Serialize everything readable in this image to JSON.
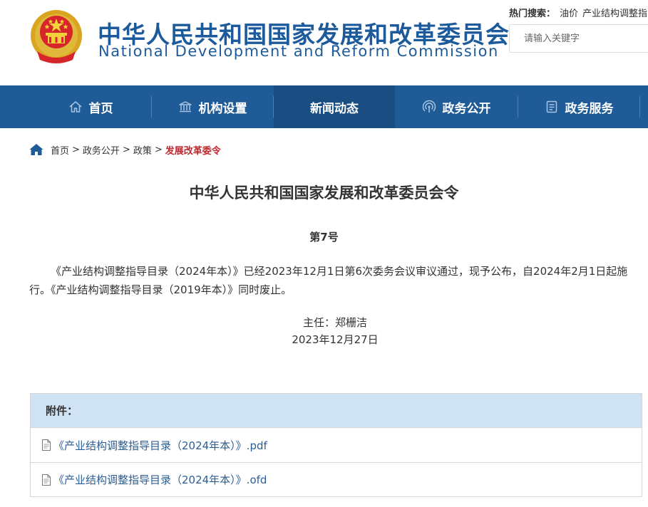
{
  "header": {
    "title_cn": "中华人民共和国国家发展和改革委员会",
    "title_en": "National Development and Reform Commission",
    "hot_search_label": "热门搜索：",
    "hot_search_links": [
      "油价",
      "产业结构调整指"
    ],
    "search_placeholder": "请输入关键字"
  },
  "nav": {
    "items": [
      {
        "label": "首页",
        "icon": "home-outline-icon"
      },
      {
        "label": "机构设置",
        "icon": "institution-building-icon"
      },
      {
        "label": "新闻动态",
        "icon": ""
      },
      {
        "label": "政务公开",
        "icon": "broadcast-icon"
      },
      {
        "label": "政务服务",
        "icon": "document-service-icon"
      }
    ],
    "active_index": 2
  },
  "breadcrumb": {
    "items": [
      "首页",
      "政务公开",
      "政策"
    ],
    "separator": ">",
    "current": "发展改革委令"
  },
  "article": {
    "title": "中华人民共和国国家发展和改革委员会令",
    "number": "第7号",
    "body": "《产业结构调整指导目录（2024年本）》已经2023年12月1日第6次委务会议审议通过，现予公布，自2024年2月1日起施行。《产业结构调整指导目录（2019年本）》同时废止。",
    "signer": "主任：郑栅洁",
    "date": "2023年12月27日"
  },
  "attachments": {
    "heading": "附件：",
    "files": [
      {
        "name": "《产业结构调整指导目录（2024年本）》.pdf"
      },
      {
        "name": "《产业结构调整指导目录（2024年本）》.ofd"
      }
    ]
  },
  "colors": {
    "brand_blue": "#1d5a9c",
    "nav_bg": "#1f5b97",
    "nav_active": "#1a4d82",
    "breadcrumb_current": "#c0282d",
    "attach_head_bg": "#cfe3f5",
    "link_blue": "#2b5d95"
  }
}
